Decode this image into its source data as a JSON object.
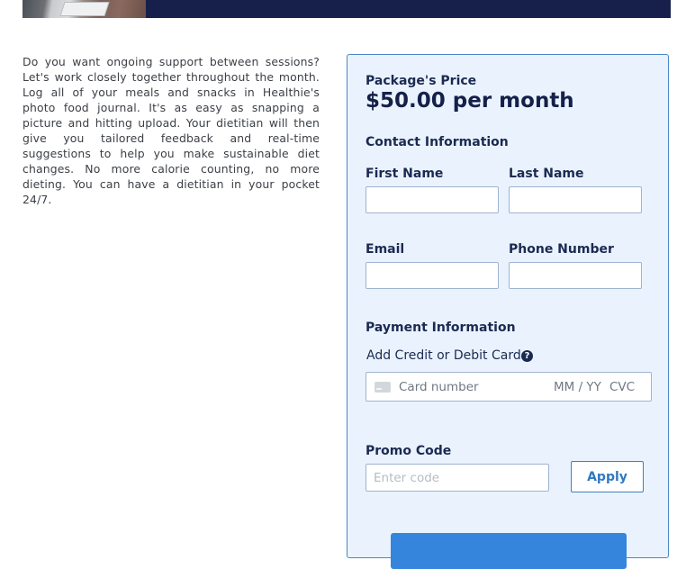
{
  "description": "Do you want ongoing support between sessions? Let's work closely together throughout the month. Log all of your meals and snacks in Healthie's photo food journal. It's as easy as snapping a picture and hitting upload. Your dietitian will then give you tailored feedback and real-time suggestions to help you make sustainable diet changes. No more calorie counting, no more dieting. You can have a dietitian in your pocket 24/7.",
  "package": {
    "price_label": "Package's Price",
    "price": "$50.00 per month"
  },
  "contact": {
    "heading": "Contact Information",
    "first_name_label": "First Name",
    "last_name_label": "Last Name",
    "email_label": "Email",
    "phone_label": "Phone Number"
  },
  "payment": {
    "heading": "Payment Information",
    "card_label": "Add Credit or Debit Card",
    "help_glyph": "?",
    "card_number_placeholder": "Card number",
    "expiry_placeholder": "MM / YY",
    "cvc_placeholder": "CVC"
  },
  "promo": {
    "label": "Promo Code",
    "placeholder": "Enter code",
    "apply_label": "Apply"
  },
  "colors": {
    "banner": "#16204a",
    "panel_bg": "#eaf3fd",
    "panel_border": "#4a86c6",
    "accent": "#3585dc",
    "text_dark": "#1b2a52"
  },
  "icons": {
    "help": "question-circle-icon",
    "card": "credit-card-icon"
  }
}
